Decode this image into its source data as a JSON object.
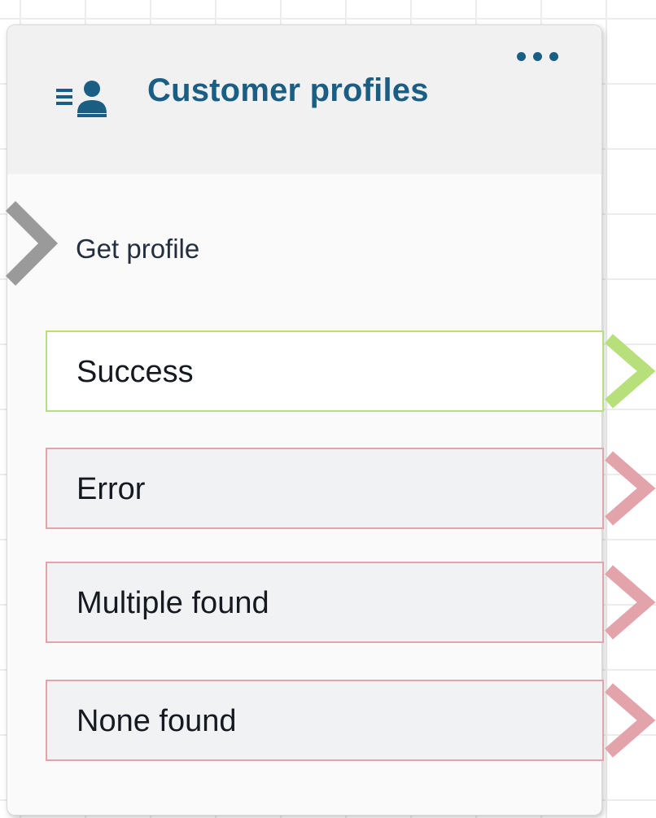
{
  "block": {
    "title": "Customer profiles",
    "action": "Get profile",
    "menu_icon": "more-options-icon",
    "type_icon": "customer-profiles-icon"
  },
  "branches": [
    {
      "label": "Success",
      "status": "success",
      "color": "#b7e07a"
    },
    {
      "label": "Error",
      "status": "error",
      "color": "#e3a3ab"
    },
    {
      "label": "Multiple found",
      "status": "error",
      "color": "#e3a3ab"
    },
    {
      "label": "None found",
      "status": "error",
      "color": "#e3a3ab"
    }
  ],
  "colors": {
    "title": "#1b5e84",
    "input_connector": "#9a9a9a",
    "success": "#b7e07a",
    "error": "#e3a3ab"
  }
}
